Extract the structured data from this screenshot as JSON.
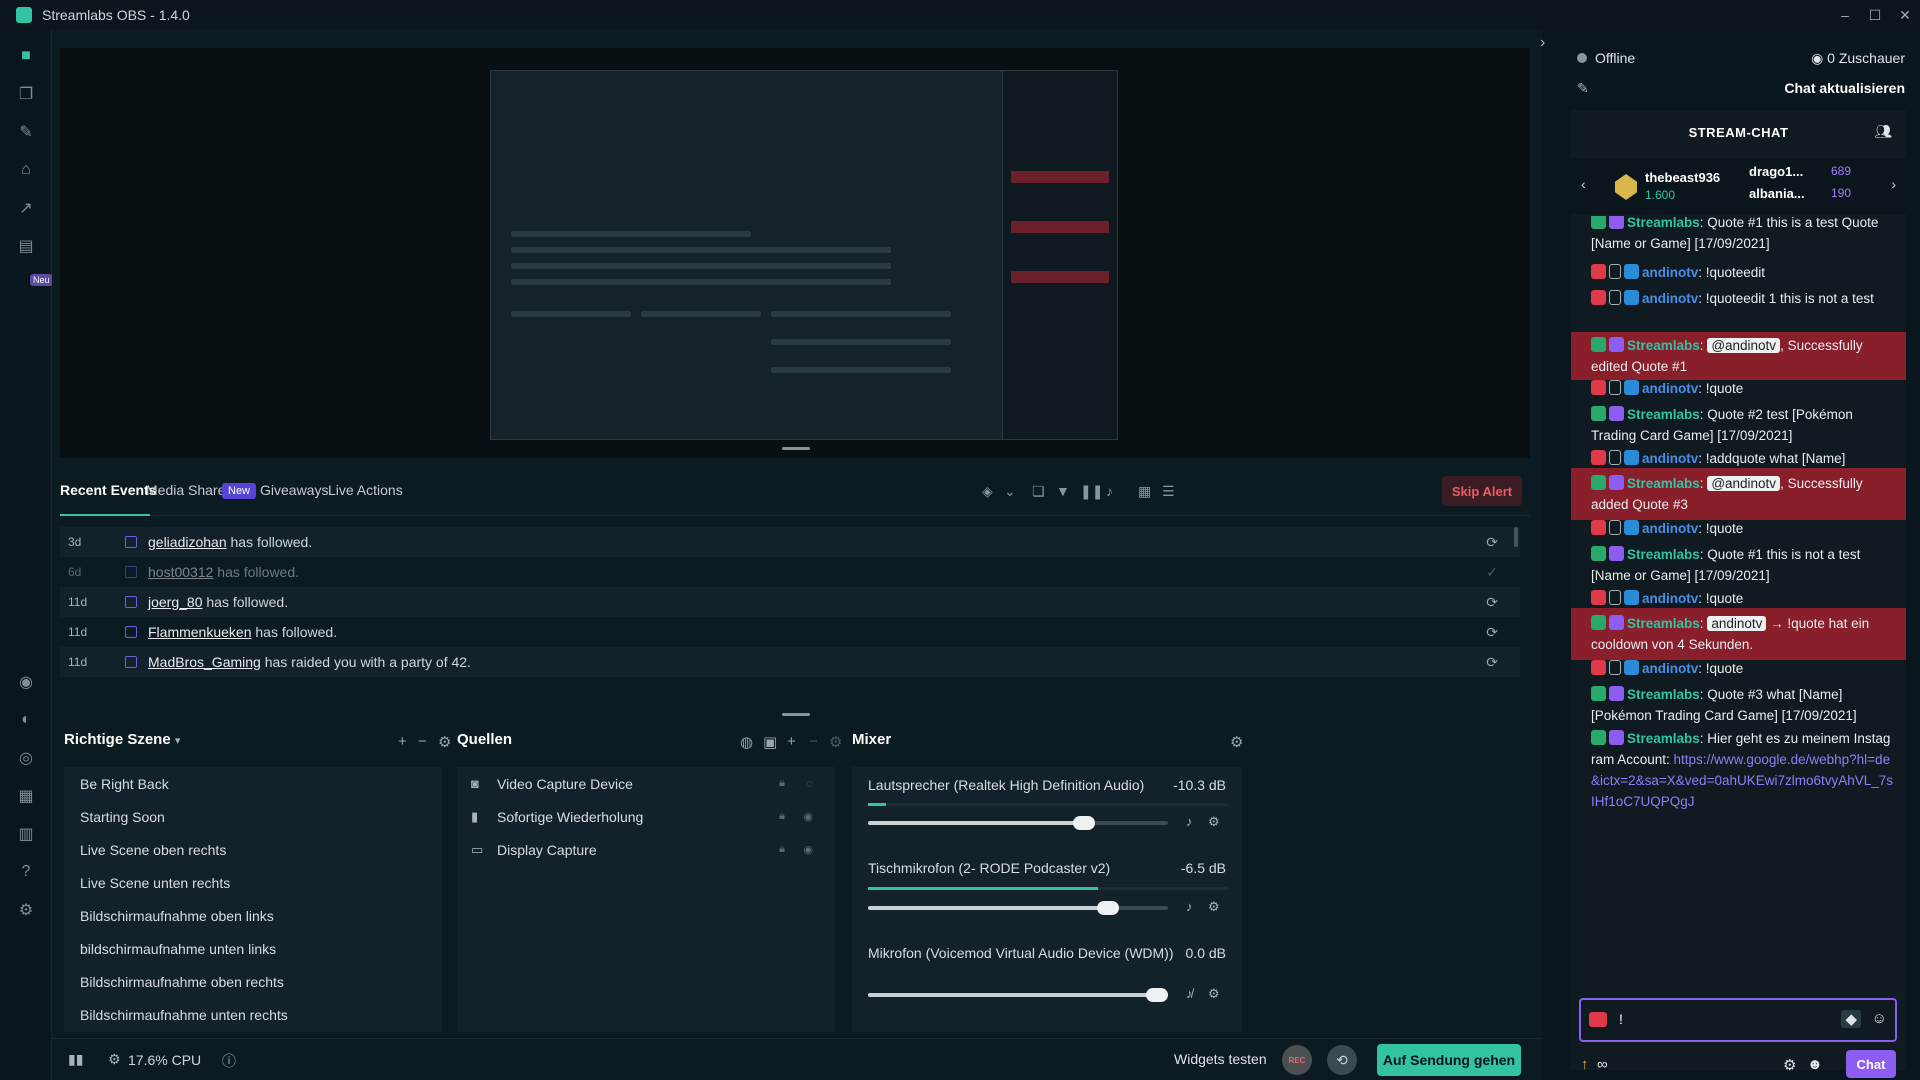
{
  "app": {
    "title": "Streamlabs OBS - 1.4.0"
  },
  "nav": {
    "new_badge": "Neu"
  },
  "tabs": [
    {
      "label": "Recent Events"
    },
    {
      "label": "Media Share"
    },
    {
      "label": "Giveaways"
    },
    {
      "label": "Live Actions"
    }
  ],
  "media_share_badge": "New",
  "skip_alert": "Skip Alert",
  "events": [
    {
      "time": "3d",
      "user": "geliadizohan",
      "text": " has followed."
    },
    {
      "time": "6d",
      "user": "host00312",
      "text": " has followed."
    },
    {
      "time": "11d",
      "user": "joerg_80",
      "text": " has followed."
    },
    {
      "time": "11d",
      "user": "Flammenkueken",
      "text": " has followed."
    },
    {
      "time": "11d",
      "user": "MadBros_Gaming",
      "text": " has raided you with a party of 42."
    }
  ],
  "scenes": {
    "title": "Richtige Szene",
    "items": [
      "Be Right Back",
      "Starting Soon",
      "Live Scene oben rechts",
      "Live Scene unten rechts",
      "Bildschirmaufnahme oben links",
      "bildschirmaufnahme unten links",
      "Bildschirmaufnahme oben rechts",
      "Bildschirmaufnahme unten rechts"
    ]
  },
  "sources": {
    "title": "Quellen",
    "items": [
      "Video Capture Device",
      "Sofortige Wiederholung",
      "Display Capture"
    ]
  },
  "mixer": {
    "title": "Mixer",
    "channels": [
      {
        "name": "Lautsprecher (Realtek High Definition Audio)",
        "db": "-10.3 dB",
        "level": 0.72
      },
      {
        "name": "Tischmikrofon (2- RODE Podcaster v2)",
        "db": "-6.5 dB",
        "level": 0.8
      },
      {
        "name": "Mikrofon (Voicemod Virtual Audio Device (WDM))",
        "db": "0.0 dB",
        "level": 1.0
      }
    ]
  },
  "footer": {
    "cpu": "17.6% CPU",
    "widgets_test": "Widgets testen",
    "rec_label": "REC",
    "go_live": "Auf Sendung gehen"
  },
  "chat_panel": {
    "status": "Offline",
    "viewers": "0 Zuschauer",
    "refresh": "Chat aktualisieren",
    "heading": "STREAM-CHAT",
    "leader1_name": "thebeast936",
    "leader1_value": "1.600",
    "leader2_name": "drago1...",
    "leader2_value": "689",
    "leader3_name": "albania...",
    "leader3_value": "190",
    "input_value": "!",
    "chat_button": "Chat",
    "infinity": "∞"
  },
  "chat_messages": [
    {
      "user": "Streamlabs",
      "text": ": Quote #1 this is a test Quote [Name or Game] [17/09/2021]"
    },
    {
      "user": "andinotv",
      "text": ": !quoteedit"
    },
    {
      "user": "andinotv",
      "text": ": !quoteedit 1 this is not a test"
    },
    {
      "user": "Streamlabs",
      "mention": "@andinotv",
      "text": ", Successfully edited Quote #1"
    },
    {
      "user": "andinotv",
      "text": ": !quote"
    },
    {
      "user": "Streamlabs",
      "text": ": Quote #2 test [Pokémon Trading Card Game] [17/09/2021]"
    },
    {
      "user": "andinotv",
      "text": ": !addquote what [Name]"
    },
    {
      "user": "Streamlabs",
      "mention": "@andinotv",
      "text": ", Successfully added Quote #3"
    },
    {
      "user": "andinotv",
      "text": ": !quote"
    },
    {
      "user": "Streamlabs",
      "text": ": Quote #1 this is not a test [Name or Game] [17/09/2021]"
    },
    {
      "user": "andinotv",
      "text": ": !quote"
    },
    {
      "user": "Streamlabs",
      "mention": "andinotv",
      "text": " → !quote hat ein cooldown von 4 Sekunden."
    },
    {
      "user": "andinotv",
      "text": ": !quote"
    },
    {
      "user": "Streamlabs",
      "text": ": Quote #3 what [Name] [Pokémon Trading Card Game] [17/09/2021]"
    },
    {
      "user": "Streamlabs",
      "text": ": Hier geht es zu meinem Instagram Account: ",
      "link": "https://www.google.de/webhp?hl=de&ictx=2&sa=X&ved=0ahUKEwi7zlmo6tvyAhVL_7sIHf1oC7UQPQgJ"
    }
  ]
}
